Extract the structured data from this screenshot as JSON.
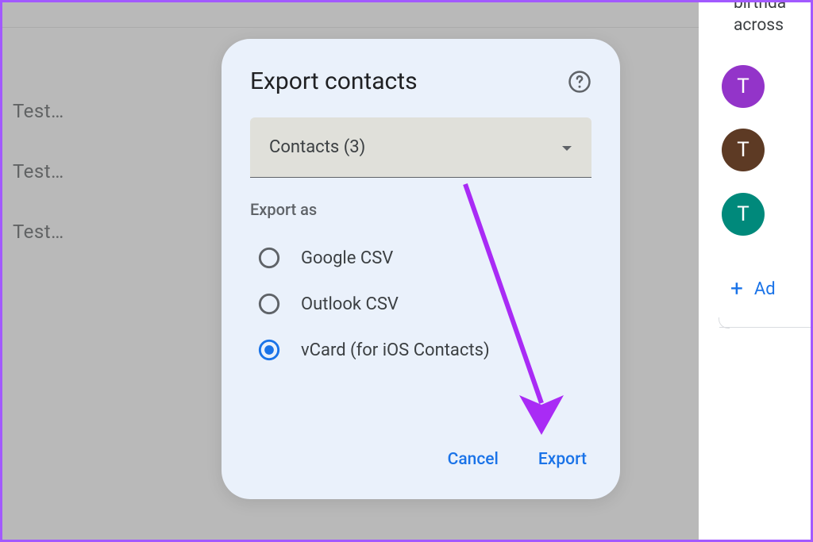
{
  "background": {
    "items": [
      "Test…",
      "Test…",
      "Test…"
    ],
    "sideText": [
      "birthda",
      "across"
    ],
    "avatars": [
      {
        "letter": "T",
        "color": "#9334c9"
      },
      {
        "letter": "T",
        "color": "#5d3a24"
      },
      {
        "letter": "T",
        "color": "#00897b"
      }
    ],
    "addButton": {
      "icon": "+",
      "label": "Ad"
    }
  },
  "modal": {
    "title": "Export contacts",
    "dropdown": "Contacts (3)",
    "sectionLabel": "Export as",
    "options": [
      {
        "label": "Google CSV",
        "selected": false
      },
      {
        "label": "Outlook CSV",
        "selected": false
      },
      {
        "label": "vCard (for iOS Contacts)",
        "selected": true
      }
    ],
    "cancelLabel": "Cancel",
    "exportLabel": "Export"
  }
}
